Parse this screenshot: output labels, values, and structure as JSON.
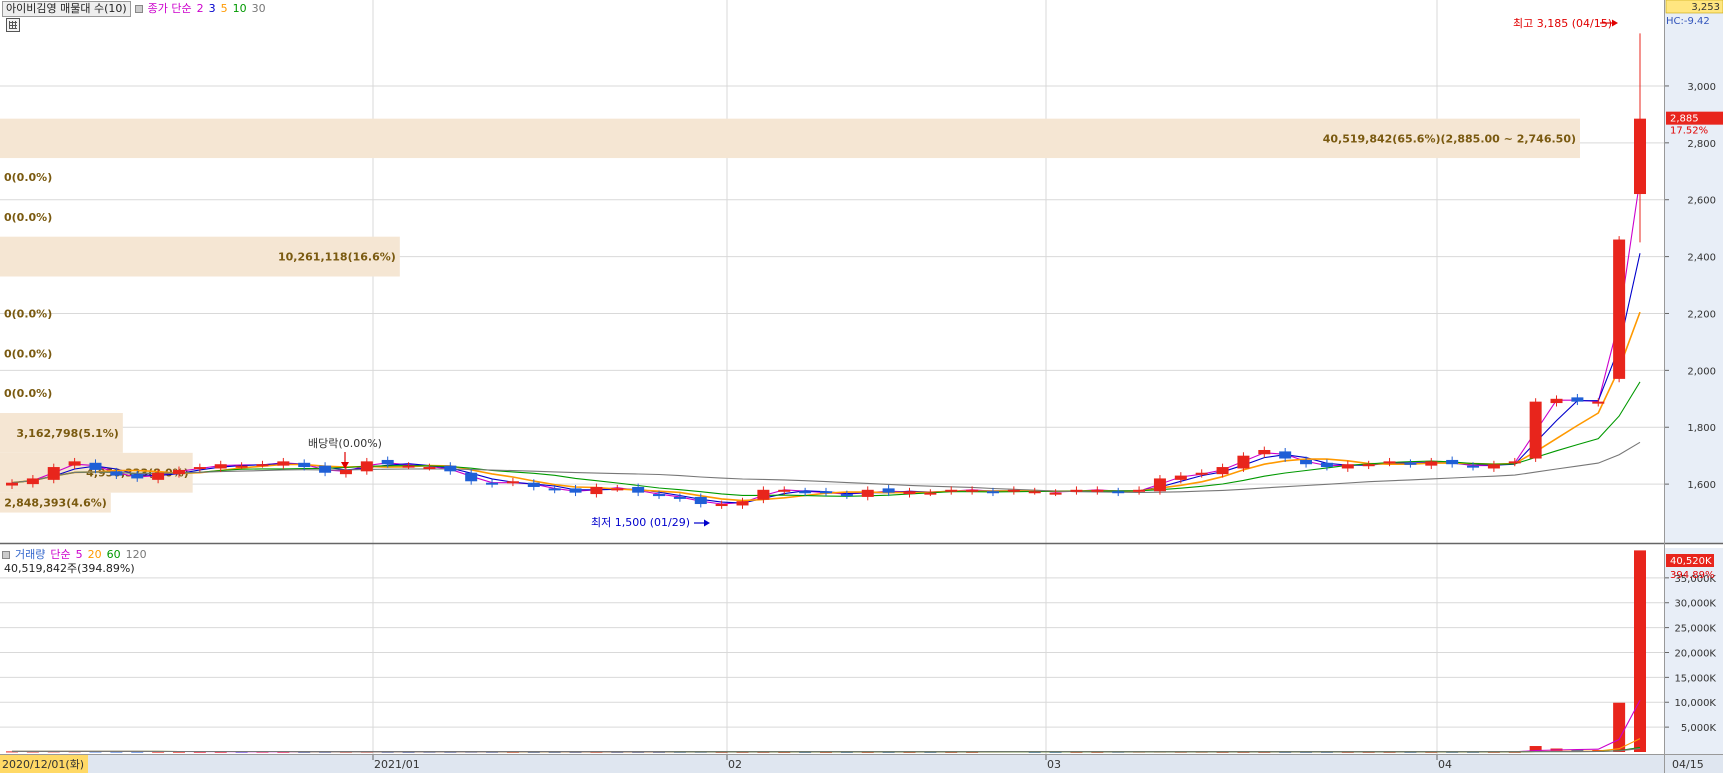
{
  "price_panel": {
    "indicator_label": "아이비김영 매물대 수(10)",
    "ma_label": "종가 단순",
    "ma_periods": [
      "2",
      "3",
      "5",
      "10",
      "30"
    ],
    "ma_colors": [
      "#cc00cc",
      "#0000cc",
      "#ff9900",
      "#009900",
      "#777777"
    ],
    "high_label": "최고 3,185 (04/15)",
    "low_label": "최저 1,500 (01/29)",
    "dividend_label": "배당락(0.00%)",
    "current_price_tag": "2,885",
    "current_change_tag": "17.52%",
    "top_tag": "3,253",
    "hc_tag": "HC:-9.42"
  },
  "volume_panel": {
    "label": "거래량",
    "ma_label": "단순",
    "ma_periods": [
      "5",
      "20",
      "60",
      "120"
    ],
    "ma_colors": [
      "#cc00cc",
      "#ff9900",
      "#009900",
      "#777777"
    ],
    "summary": "40,519,842주(394.89%)",
    "current_tag": "40,520K",
    "current_pct_tag": "394.89%"
  },
  "date_axis": {
    "first_date": "2020/12/01(화)",
    "last_date": "04/15",
    "month_labels": [
      "2021/01",
      "02",
      "03",
      "04"
    ]
  },
  "chart_data": {
    "type": "candlestick",
    "price_axis": {
      "ticks": [
        "1,600",
        "1,800",
        "2,000",
        "2,200",
        "2,400",
        "2,600",
        "2,800",
        "3,000"
      ],
      "range": [
        1400,
        3253
      ]
    },
    "volume_axis": {
      "ticks": [
        "5,000K",
        "10,000K",
        "15,000K",
        "20,000K",
        "25,000K",
        "30,000K",
        "35,000K"
      ],
      "range": [
        0,
        41000
      ]
    },
    "high": 3185,
    "low": 1500,
    "last_close": 2885,
    "volume_profile": [
      {
        "label": "2,848,393(4.6%)",
        "price_from": 1500,
        "price_to": 1570,
        "share": 4.6
      },
      {
        "label": "4,950,323(8.0%)",
        "price_from": 1570,
        "price_to": 1710,
        "share": 8.0
      },
      {
        "label": "3,162,798(5.1%)",
        "price_from": 1710,
        "price_to": 1850,
        "share": 5.1
      },
      {
        "label": "0(0.0%)",
        "price_from": 1850,
        "price_to": 1990,
        "share": 0
      },
      {
        "label": "0(0.0%)",
        "price_from": 1990,
        "price_to": 2130,
        "share": 0
      },
      {
        "label": "0(0.0%)",
        "price_from": 2130,
        "price_to": 2270,
        "share": 0
      },
      {
        "label": "10,261,118(16.6%)",
        "price_from": 2330,
        "price_to": 2470,
        "share": 16.6
      },
      {
        "label": "0(0.0%)",
        "price_from": 2470,
        "price_to": 2610,
        "share": 0
      },
      {
        "label": "0(0.0%)",
        "price_from": 2610,
        "price_to": 2750,
        "share": 0
      },
      {
        "label": "40,519,842(65.6%)(2,885.00 ~ 2,746.50)",
        "price_from": 2746.5,
        "price_to": 2885,
        "share": 65.6
      }
    ],
    "close_series": [
      1605,
      1620,
      1660,
      1680,
      1650,
      1630,
      1620,
      1640,
      1650,
      1660,
      1670,
      1665,
      1670,
      1680,
      1660,
      1640,
      1650,
      1680,
      1670,
      1665,
      1660,
      1645,
      1610,
      1600,
      1610,
      1590,
      1580,
      1570,
      1590,
      1585,
      1570,
      1560,
      1550,
      1530,
      1530,
      1540,
      1580,
      1580,
      1570,
      1570,
      1560,
      1580,
      1570,
      1575,
      1570,
      1580,
      1580,
      1570,
      1580,
      1575,
      1570,
      1580,
      1580,
      1570,
      1580,
      1620,
      1630,
      1640,
      1660,
      1700,
      1720,
      1690,
      1670,
      1660,
      1670,
      1670,
      1680,
      1670,
      1680,
      1670,
      1660,
      1670,
      1680,
      1890,
      1900,
      1890,
      1890,
      2460,
      2885
    ],
    "volume_series_k": [
      120,
      110,
      130,
      140,
      120,
      100,
      90,
      80,
      70,
      60,
      60,
      70,
      80,
      60,
      50,
      60,
      70,
      80,
      60,
      50,
      70,
      60,
      80,
      60,
      50,
      40,
      40,
      40,
      50,
      40,
      40,
      40,
      50,
      60,
      40,
      40,
      40,
      30,
      30,
      30,
      30,
      30,
      30,
      30,
      30,
      30,
      30,
      200,
      200,
      40,
      40,
      40,
      40,
      60,
      80,
      90,
      60,
      70,
      40,
      40,
      40,
      40,
      40,
      40,
      40,
      40,
      40,
      40,
      40,
      40,
      40,
      40,
      40,
      1200,
      700,
      500,
      400,
      9900,
      40520
    ]
  }
}
